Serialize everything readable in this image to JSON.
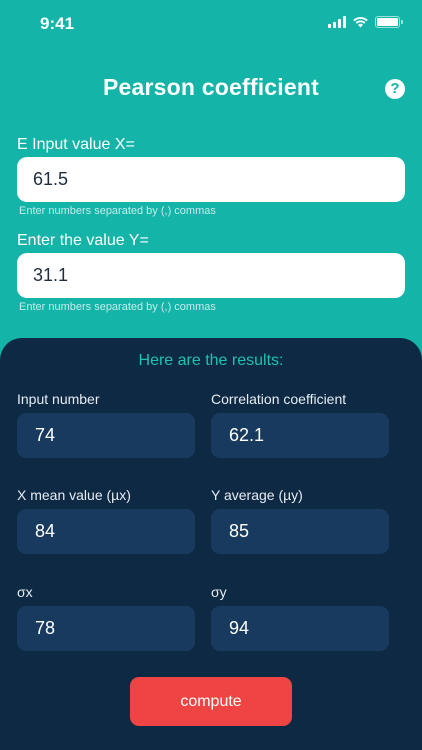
{
  "status_bar": {
    "time": "9:41"
  },
  "header": {
    "title": "Pearson coefficient",
    "help_glyph": "?"
  },
  "input_x": {
    "label": "E Input value X=",
    "value": "61.5",
    "hint": "Enter numbers separated by (,) commas"
  },
  "input_y": {
    "label": "Enter the value Y=",
    "value": "31.1",
    "hint": "Enter numbers separated by (,) commas"
  },
  "results": {
    "title": "Here are the results:",
    "input_number": {
      "label": "Input number",
      "value": "74"
    },
    "correlation": {
      "label": "Correlation coefficient",
      "value": "62.1"
    },
    "x_mean": {
      "label": "X mean value (µx)",
      "value": "84"
    },
    "y_average": {
      "label": "Y average (µy)",
      "value": "85"
    },
    "sigma_x": {
      "label": "σx",
      "value": "78"
    },
    "sigma_y": {
      "label": "σy",
      "value": "94"
    }
  },
  "compute_button": {
    "label": "compute"
  },
  "colors": {
    "background": "#14B4A8",
    "panel": "#0E2944",
    "result_box": "#183A5E",
    "accent": "#1DC2B1",
    "button": "#EF4444"
  },
  "icons": [
    "signal-icon",
    "wifi-icon",
    "battery-icon",
    "help-icon"
  ]
}
